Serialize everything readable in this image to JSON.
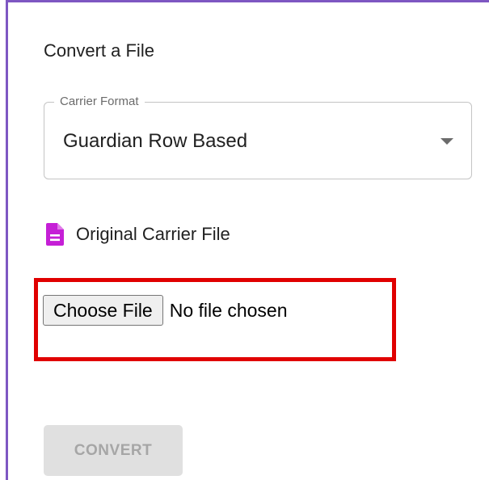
{
  "card": {
    "title": "Convert a File"
  },
  "carrier_select": {
    "label": "Carrier Format",
    "value": "Guardian Row Based",
    "arrow_icon": "dropdown-arrow-icon"
  },
  "file_section": {
    "icon": "document-icon",
    "icon_color": "#c51fd6",
    "label": "Original Carrier File"
  },
  "file_input": {
    "button_label": "Choose File",
    "status": "No file chosen"
  },
  "actions": {
    "convert_label": "CONVERT",
    "convert_disabled": true
  },
  "colors": {
    "frame_accent": "#7e57c2",
    "highlight": "#e00000"
  }
}
